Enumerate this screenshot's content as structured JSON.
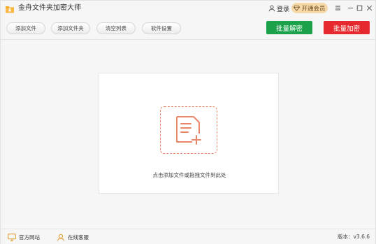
{
  "app": {
    "title": "金舟文件夹加密大师",
    "logo_icon": "folder-logo-icon",
    "accent_color": "#f5a623"
  },
  "header": {
    "login_label": "登录",
    "vip_label": "开通会员"
  },
  "toolbar": {
    "buttons": [
      {
        "label": "添加文件"
      },
      {
        "label": "添加文件夹"
      },
      {
        "label": "清空列表"
      },
      {
        "label": "软件设置"
      }
    ],
    "batch_decrypt_label": "批量解密",
    "batch_encrypt_label": "批量加密",
    "decrypt_color": "#1aa14a",
    "encrypt_color": "#e5292e"
  },
  "main": {
    "drop_hint": "点击添加文件或拖拽文件到此处",
    "drop_icon": "add-file-icon"
  },
  "footer": {
    "website_label": "官方网站",
    "support_label": "在线客服",
    "version": "版本：v3.6.6"
  }
}
